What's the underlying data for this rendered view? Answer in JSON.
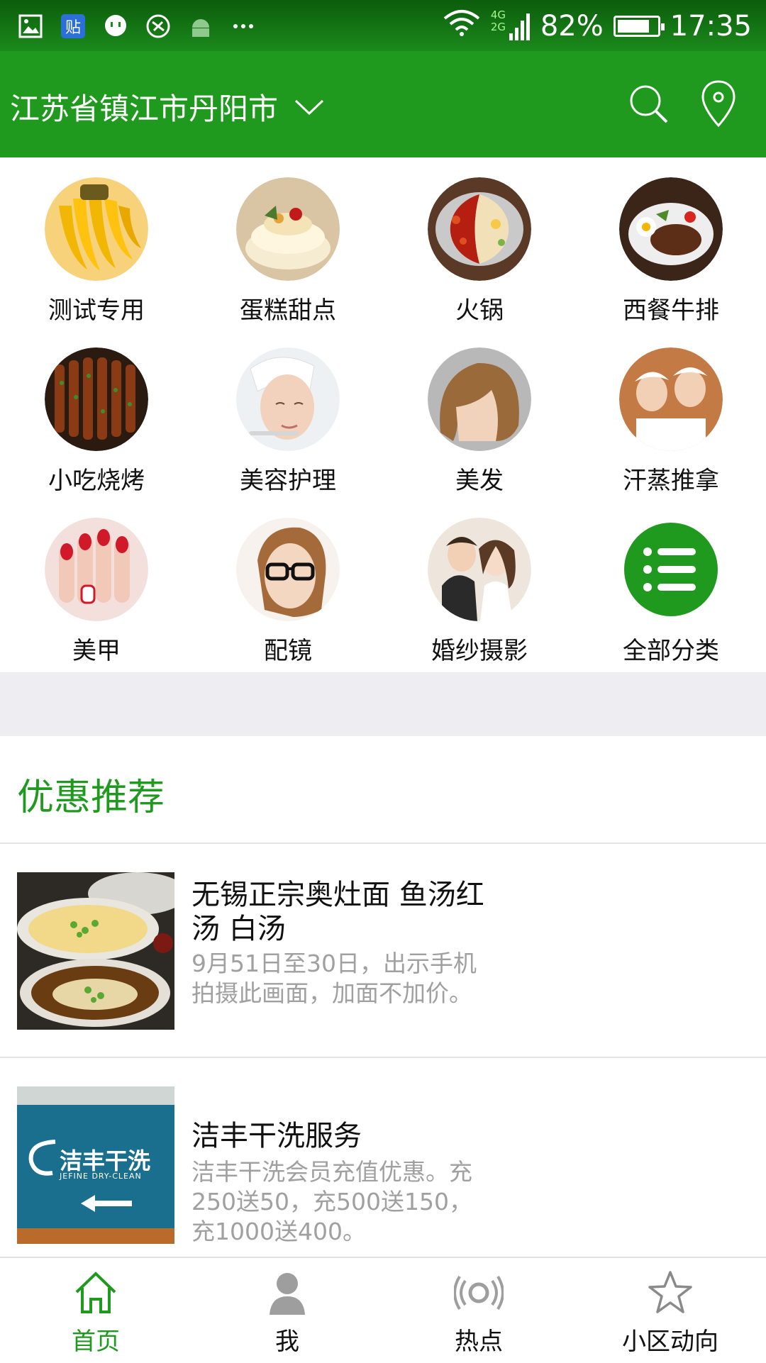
{
  "status_bar": {
    "network": "4G 2G",
    "battery": "82%",
    "battery_level": 0.82,
    "time": "17:35",
    "notification_icons": [
      "gallery-icon",
      "tieba-icon",
      "chat-icon",
      "vpn-icon",
      "android-icon",
      "more-icon"
    ]
  },
  "header": {
    "location": "江苏省镇江市丹阳市",
    "accent_color": "#1f9a1f"
  },
  "categories": [
    {
      "label": "测试专用",
      "icon": "banana-icon"
    },
    {
      "label": "蛋糕甜点",
      "icon": "cake-icon"
    },
    {
      "label": "火锅",
      "icon": "hotpot-icon"
    },
    {
      "label": "西餐牛排",
      "icon": "steak-icon"
    },
    {
      "label": "小吃烧烤",
      "icon": "skewer-icon"
    },
    {
      "label": "美容护理",
      "icon": "facial-icon"
    },
    {
      "label": "美发",
      "icon": "hair-icon"
    },
    {
      "label": "汗蒸推拿",
      "icon": "sauna-icon"
    },
    {
      "label": "美甲",
      "icon": "nail-icon"
    },
    {
      "label": "配镜",
      "icon": "glasses-icon"
    },
    {
      "label": "婚纱摄影",
      "icon": "wedding-icon"
    },
    {
      "label": "全部分类",
      "icon": "list-icon"
    }
  ],
  "recommend": {
    "title": "优惠推荐",
    "deals": [
      {
        "title": "无锡正宗奥灶面 鱼汤红汤 白汤",
        "desc": "9月51日至30日，出示手机拍摄此画面，加面不加价。",
        "thumb": "noodle-photo"
      },
      {
        "title": "洁丰干洗服务",
        "desc": "洁丰干洗会员充值优惠。充250送50，充500送150，充1000送400。",
        "thumb": "dryclean-photo",
        "thumb_text": "洁丰干洗",
        "thumb_subtext": "JEFINE DRY-CLEAN"
      }
    ]
  },
  "tabbar": {
    "items": [
      {
        "label": "首页",
        "icon": "home-icon",
        "active": true
      },
      {
        "label": "我",
        "icon": "person-icon",
        "active": false
      },
      {
        "label": "热点",
        "icon": "broadcast-icon",
        "active": false
      },
      {
        "label": "小区动向",
        "icon": "star-icon",
        "active": false
      }
    ]
  }
}
